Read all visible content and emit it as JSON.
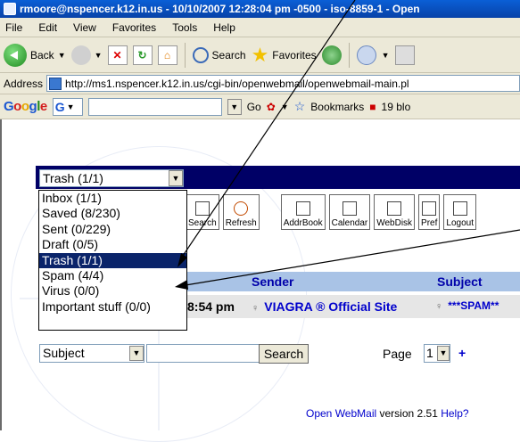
{
  "window": {
    "title": "rmoore@nspencer.k12.in.us - 10/10/2007 12:28:04 pm -0500 - iso-8859-1 - Open"
  },
  "menu": [
    "File",
    "Edit",
    "View",
    "Favorites",
    "Tools",
    "Help"
  ],
  "toolbar": {
    "back_label": "Back",
    "search_label": "Search",
    "favorites_label": "Favorites"
  },
  "address": {
    "label": "Address",
    "url": "http://ms1.nspencer.k12.in.us/cgi-bin/openwebmail/openwebmail-main.pl"
  },
  "google_bar": {
    "logo": "Google",
    "go_label": "Go",
    "bookmarks_label": "Bookmarks",
    "blocked_label": "19 blo"
  },
  "mail": {
    "folder_selected": "Trash (1/1)",
    "folders": [
      "Inbox (1/1)",
      "Saved (8/230)",
      "Sent (0/229)",
      "Draft (0/5)",
      "Trash (1/1)",
      "Spam (4/4)",
      "Virus (0/0)",
      "Important stuff (0/0)"
    ],
    "selected_index": 4,
    "icon_buttons": [
      "Search",
      "Refresh",
      "AddrBook",
      "Calendar",
      "WebDisk",
      "Pref",
      "Logout"
    ],
    "columns": {
      "sender": "Sender",
      "subject": "Subject"
    },
    "row": {
      "time": "8:54 pm",
      "sender": "VIAGRA ® Official Site",
      "subject": "***SPAM**"
    },
    "search": {
      "field_select": "Subject",
      "button": "Search",
      "page_label": "Page",
      "page_value": "1",
      "plus": "+"
    },
    "footer": {
      "app": "Open WebMail",
      "version": "version 2.51",
      "help": "Help?"
    }
  }
}
